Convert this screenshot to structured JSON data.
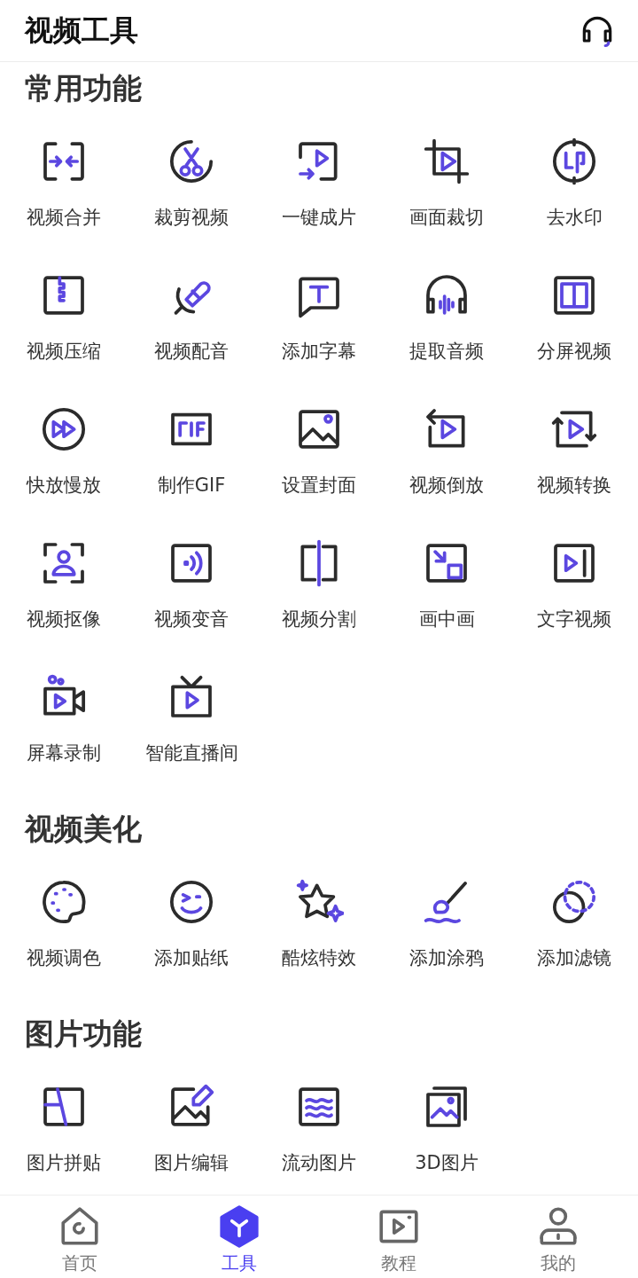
{
  "header": {
    "title": "视频工具"
  },
  "sections": [
    {
      "title": "常用功能",
      "items": [
        {
          "label": "视频合并"
        },
        {
          "label": "裁剪视频"
        },
        {
          "label": "一键成片"
        },
        {
          "label": "画面裁切"
        },
        {
          "label": "去水印"
        },
        {
          "label": "视频压缩"
        },
        {
          "label": "视频配音"
        },
        {
          "label": "添加字幕"
        },
        {
          "label": "提取音频"
        },
        {
          "label": "分屏视频"
        },
        {
          "label": "快放慢放"
        },
        {
          "label": "制作GIF"
        },
        {
          "label": "设置封面"
        },
        {
          "label": "视频倒放"
        },
        {
          "label": "视频转换"
        },
        {
          "label": "视频抠像"
        },
        {
          "label": "视频变音"
        },
        {
          "label": "视频分割"
        },
        {
          "label": "画中画"
        },
        {
          "label": "文字视频"
        },
        {
          "label": "屏幕录制"
        },
        {
          "label": "智能直播间"
        }
      ]
    },
    {
      "title": "视频美化",
      "items": [
        {
          "label": "视频调色"
        },
        {
          "label": "添加贴纸"
        },
        {
          "label": "酷炫特效"
        },
        {
          "label": "添加涂鸦"
        },
        {
          "label": "添加滤镜"
        }
      ]
    },
    {
      "title": "图片功能",
      "items": [
        {
          "label": "图片拼贴"
        },
        {
          "label": "图片编辑"
        },
        {
          "label": "流动图片"
        },
        {
          "label": "3D图片"
        }
      ]
    }
  ],
  "tab_bar": [
    {
      "label": "首页",
      "selected": false
    },
    {
      "label": "工具",
      "selected": true
    },
    {
      "label": "教程",
      "selected": false
    },
    {
      "label": "我的",
      "selected": false
    }
  ]
}
